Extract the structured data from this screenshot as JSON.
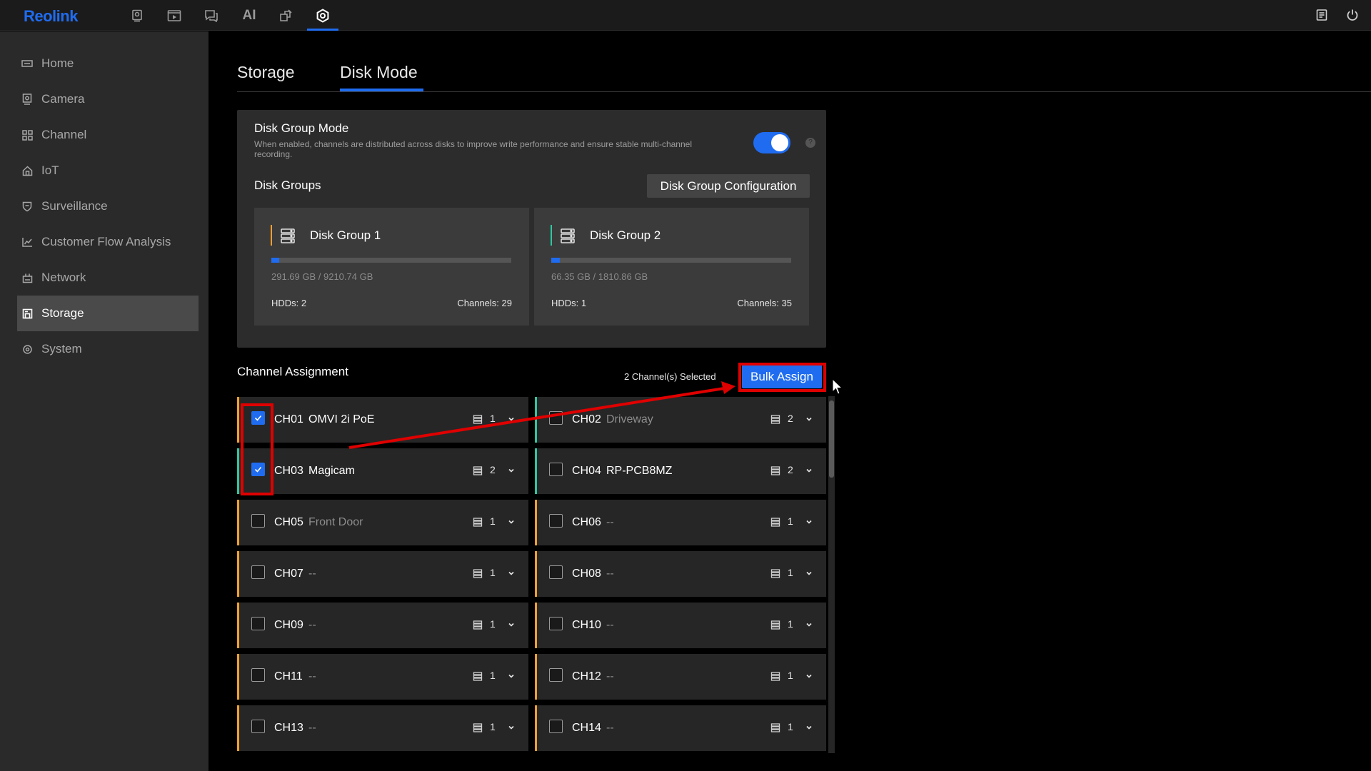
{
  "app": {
    "logo": "Reolink"
  },
  "topbar": {
    "nav": [
      {
        "icon": "playback-camera-icon"
      },
      {
        "icon": "playback-icon"
      },
      {
        "icon": "messages-icon"
      },
      {
        "icon": "ai-icon",
        "label": "AI"
      },
      {
        "icon": "apps-icon"
      },
      {
        "icon": "settings-icon",
        "active": true
      }
    ],
    "right": [
      {
        "icon": "log-icon"
      },
      {
        "icon": "power-icon"
      }
    ]
  },
  "sidebar": {
    "items": [
      {
        "label": "Home",
        "icon": "home-icon"
      },
      {
        "label": "Camera",
        "icon": "camera-icon"
      },
      {
        "label": "Channel",
        "icon": "channel-grid-icon"
      },
      {
        "label": "IoT",
        "icon": "iot-icon"
      },
      {
        "label": "Surveillance",
        "icon": "shield-icon"
      },
      {
        "label": "Customer Flow Analysis",
        "icon": "chart-icon"
      },
      {
        "label": "Network",
        "icon": "network-icon"
      },
      {
        "label": "Storage",
        "icon": "storage-icon",
        "active": true
      },
      {
        "label": "System",
        "icon": "system-gear-icon"
      }
    ]
  },
  "tabs": [
    {
      "label": "Storage"
    },
    {
      "label": "Disk Mode",
      "active": true
    }
  ],
  "disk_mode": {
    "title": "Disk Group Mode",
    "description": "When enabled, channels are distributed across disks to improve write performance and ensure stable multi-channel recording.",
    "enabled": true,
    "help": "?",
    "groups_label": "Disk Groups",
    "config_button": "Disk Group Configuration",
    "groups": [
      {
        "name": "Disk Group 1",
        "used": "291.69 GB / 9210.74 GB",
        "usage_fraction": 0.032,
        "hdds": "HDDs: 2",
        "channels": "Channels: 29",
        "accent": "#f0a030"
      },
      {
        "name": "Disk Group 2",
        "used": "66.35 GB / 1810.86 GB",
        "usage_fraction": 0.037,
        "hdds": "HDDs: 1",
        "channels": "Channels: 35",
        "accent": "#2fc7a0"
      }
    ]
  },
  "assignment": {
    "title": "Channel Assignment",
    "selected_text": "2 Channel(s) Selected",
    "bulk_button": "Bulk Assign",
    "channels": [
      {
        "id": "CH01",
        "name": "OMVI 2i PoE",
        "named": true,
        "group": "1",
        "checked": true,
        "accent": "#f0a030"
      },
      {
        "id": "CH02",
        "name": "Driveway",
        "named": false,
        "group": "2",
        "checked": false,
        "accent": "#2fc7a0"
      },
      {
        "id": "CH03",
        "name": "Magicam",
        "named": true,
        "group": "2",
        "checked": true,
        "accent": "#2fc7a0"
      },
      {
        "id": "CH04",
        "name": "RP-PCB8MZ",
        "named": true,
        "group": "2",
        "checked": false,
        "accent": "#2fc7a0"
      },
      {
        "id": "CH05",
        "name": "Front Door",
        "named": false,
        "group": "1",
        "checked": false,
        "accent": "#f0a030"
      },
      {
        "id": "CH06",
        "name": "--",
        "named": false,
        "group": "1",
        "checked": false,
        "accent": "#f0a030"
      },
      {
        "id": "CH07",
        "name": "--",
        "named": false,
        "group": "1",
        "checked": false,
        "accent": "#f0a030"
      },
      {
        "id": "CH08",
        "name": "--",
        "named": false,
        "group": "1",
        "checked": false,
        "accent": "#f0a030"
      },
      {
        "id": "CH09",
        "name": "--",
        "named": false,
        "group": "1",
        "checked": false,
        "accent": "#f0a030"
      },
      {
        "id": "CH10",
        "name": "--",
        "named": false,
        "group": "1",
        "checked": false,
        "accent": "#f0a030"
      },
      {
        "id": "CH11",
        "name": "--",
        "named": false,
        "group": "1",
        "checked": false,
        "accent": "#f0a030"
      },
      {
        "id": "CH12",
        "name": "--",
        "named": false,
        "group": "1",
        "checked": false,
        "accent": "#f0a030"
      },
      {
        "id": "CH13",
        "name": "--",
        "named": false,
        "group": "1",
        "checked": false,
        "accent": "#f0a030"
      },
      {
        "id": "CH14",
        "name": "--",
        "named": false,
        "group": "1",
        "checked": false,
        "accent": "#f0a030"
      }
    ]
  },
  "annotation_color": "#e00000",
  "accent_color": "#1f6cf0"
}
